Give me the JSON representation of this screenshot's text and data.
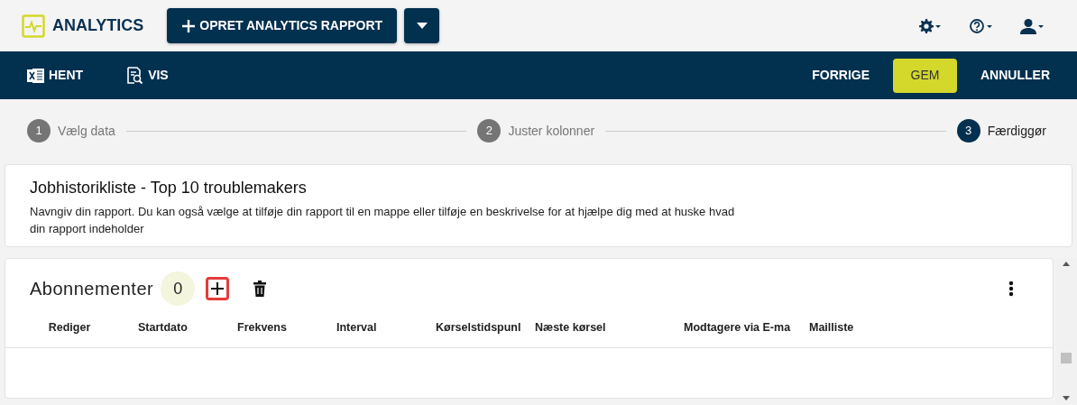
{
  "app": {
    "title": "ANALYTICS",
    "create_button": "OPRET ANALYTICS RAPPORT"
  },
  "toolbar": {
    "left": [
      {
        "label": "HENT",
        "kind": "excel"
      },
      {
        "label": "VIS",
        "kind": "view"
      }
    ],
    "right": [
      {
        "label": "FORRIGE",
        "kind": "plain"
      },
      {
        "label": "GEM",
        "kind": "primary"
      },
      {
        "label": "ANNULLER",
        "kind": "plain"
      }
    ]
  },
  "steps": [
    {
      "number": "1",
      "label": "Vælg data",
      "selected": false
    },
    {
      "number": "2",
      "label": "Juster kolonner",
      "selected": false
    },
    {
      "number": "3",
      "label": "Færdiggør",
      "selected": true
    }
  ],
  "report": {
    "title": "Jobhistorikliste - Top 10 troublemakers",
    "description": "Navngiv din rapport. Du kan også vælge at tilføje din rapport til en mappe eller tilføje en beskrivelse for at hjælpe dig med at huske hvad din rapport indeholder"
  },
  "subscriptions": {
    "title": "Abonnementer",
    "count": "0",
    "columns": [
      "Rediger",
      "Startdato",
      "Frekvens",
      "Interval",
      "Kørselstidspunl",
      "Næste kørsel",
      "Modtagere via E-ma",
      "Mailliste"
    ]
  }
}
